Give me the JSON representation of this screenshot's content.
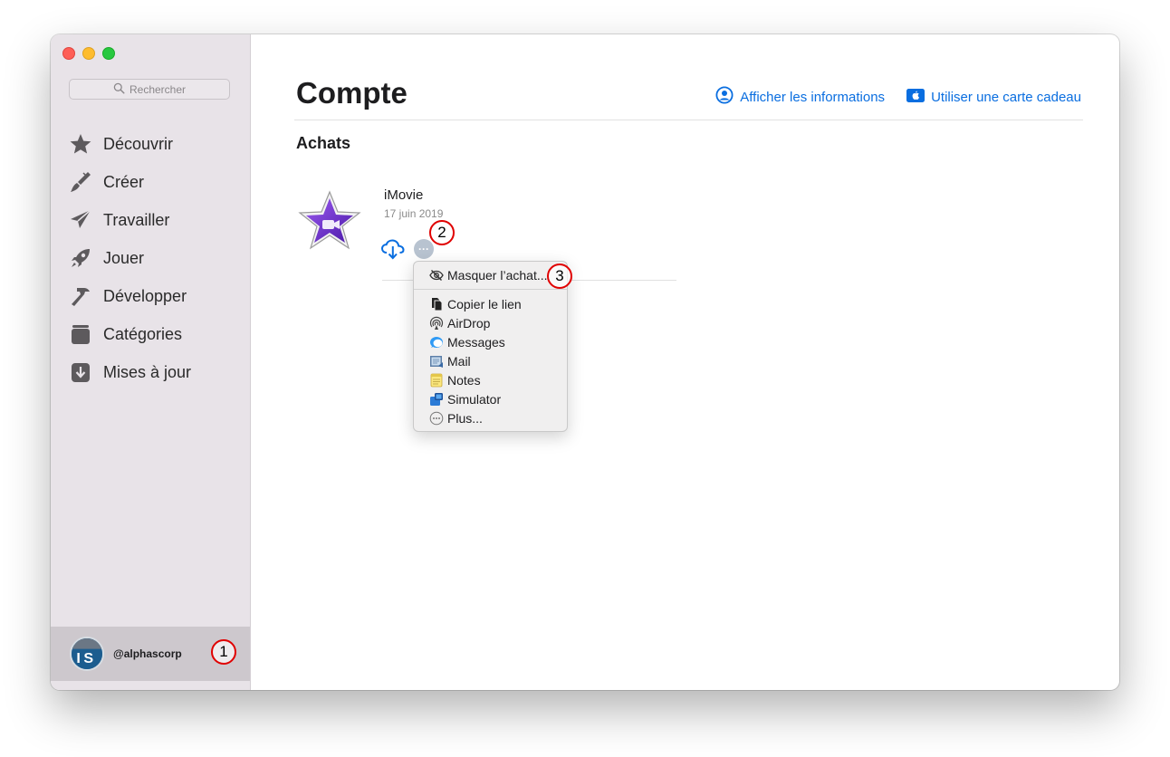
{
  "sidebar": {
    "search_placeholder": "Rechercher",
    "items": [
      {
        "label": "Découvrir",
        "icon": "star-icon"
      },
      {
        "label": "Créer",
        "icon": "brush-icon"
      },
      {
        "label": "Travailler",
        "icon": "paper-plane-icon"
      },
      {
        "label": "Jouer",
        "icon": "rocket-icon"
      },
      {
        "label": "Développer",
        "icon": "hammer-icon"
      },
      {
        "label": "Catégories",
        "icon": "stack-icon"
      },
      {
        "label": "Mises à jour",
        "icon": "download-icon"
      }
    ],
    "account": {
      "name": "@alphascorp"
    }
  },
  "main": {
    "title": "Compte",
    "links": {
      "show_info": "Afficher les informations",
      "gift_card": "Utiliser une carte cadeau"
    },
    "section": "Achats",
    "purchase": {
      "app_name": "iMovie",
      "date": "17 juin 2019",
      "more_label": "···"
    }
  },
  "context_menu": {
    "hide": "Masquer l’achat...",
    "items": [
      "Copier le lien",
      "AirDrop",
      "Messages",
      "Mail",
      "Notes",
      "Simulator",
      "Plus..."
    ]
  },
  "callouts": [
    "1",
    "2",
    "3"
  ],
  "colors": {
    "accent": "#0a6ee0",
    "sidebar_bg": "#e8e3e8",
    "callout": "#e00000"
  }
}
